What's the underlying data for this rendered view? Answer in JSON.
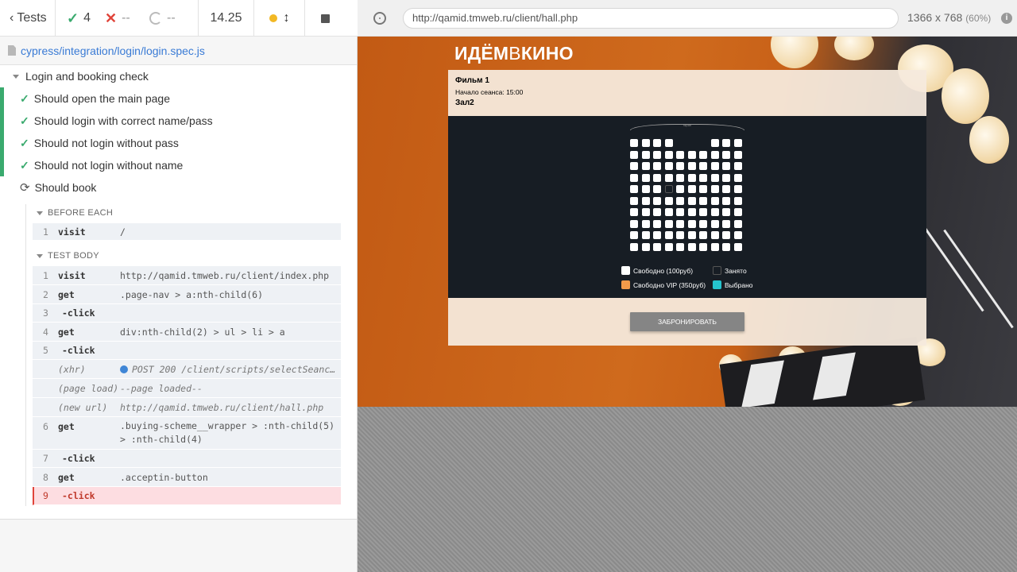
{
  "runner": {
    "back_label": "Tests",
    "passed": "4",
    "failed": "--",
    "pending": "--",
    "duration": "14.25",
    "spec_file": "cypress/integration/login/login.spec.js"
  },
  "suite": {
    "title": "Login and booking check",
    "tests": [
      {
        "title": "Should open the main page",
        "state": "passed"
      },
      {
        "title": "Should login with correct name/pass",
        "state": "passed"
      },
      {
        "title": "Should not login without pass",
        "state": "passed"
      },
      {
        "title": "Should not login without name",
        "state": "passed"
      },
      {
        "title": "Should book",
        "state": "running"
      }
    ]
  },
  "hooks": {
    "before_each": "BEFORE EACH",
    "test_body": "TEST BODY"
  },
  "before_each_commands": [
    {
      "num": "1",
      "name": "visit",
      "message": "/"
    }
  ],
  "test_body_commands": [
    {
      "num": "1",
      "name": "visit",
      "message": "http://qamid.tmweb.ru/client/index.php"
    },
    {
      "num": "2",
      "name": "get",
      "message": ".page-nav > a:nth-child(6)"
    },
    {
      "num": "3",
      "name": "-click",
      "message": ""
    },
    {
      "num": "4",
      "name": "get",
      "message": "div:nth-child(2) > ul > li > a"
    },
    {
      "num": "5",
      "name": "-click",
      "message": ""
    },
    {
      "num": "",
      "name": "(xhr)",
      "message": "POST 200 /client/scripts/selectSeance..."
    },
    {
      "num": "",
      "name": "(page load)",
      "message": "--page loaded--"
    },
    {
      "num": "",
      "name": "(new url)",
      "message": "http://qamid.tmweb.ru/client/hall.php"
    },
    {
      "num": "6",
      "name": "get",
      "message": ".buying-scheme__wrapper > :nth-child(5) > :nth-child(4)"
    },
    {
      "num": "7",
      "name": "-click",
      "message": ""
    },
    {
      "num": "8",
      "name": "get",
      "message": ".acceptin-button"
    },
    {
      "num": "9",
      "name": "-click",
      "message": ""
    }
  ],
  "aut": {
    "url": "http://qamid.tmweb.ru/client/hall.php",
    "viewport": "1366 x 768",
    "scale": "(60%)"
  },
  "app": {
    "logo_bold_1": "ИДЁМ",
    "logo_thin": "В",
    "logo_bold_2": "КИНО",
    "film_title": "Фильм 1",
    "seance_start": "Начало сеанса: 15:00",
    "hall_name": "Зал2",
    "screen_label": "экран",
    "legend": {
      "free": "Свободно (100руб)",
      "taken": "Занято",
      "vip": "Свободно VIP (350руб)",
      "selected": "Выбрано"
    },
    "book_button": "ЗАБРОНИРОВАТЬ"
  },
  "colors": {
    "pass": "#3aaa6e",
    "fail": "#e0443a",
    "legend_free": "#ffffff",
    "legend_taken": "#171d24",
    "legend_vip": "#f29a4a",
    "legend_selected": "#25c4ce"
  }
}
